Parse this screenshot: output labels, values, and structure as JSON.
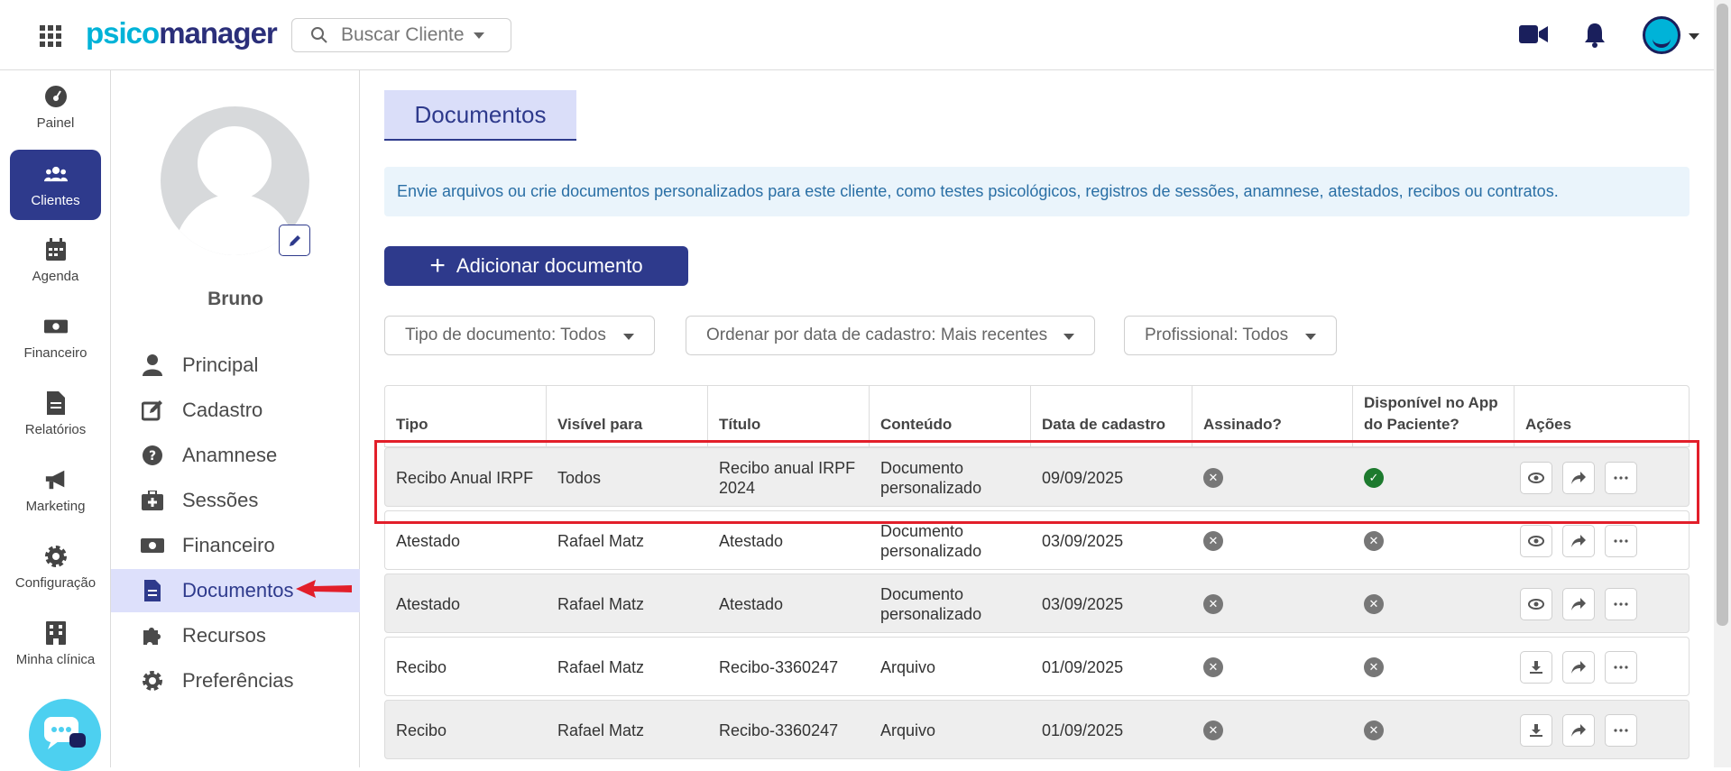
{
  "header": {
    "logo_part1": "psico",
    "logo_part2": "manager",
    "search_placeholder": "Buscar Cliente"
  },
  "leftnav": {
    "items": [
      {
        "label": "Painel",
        "icon": "dashboard-icon"
      },
      {
        "label": "Clientes",
        "icon": "users-icon",
        "active": true
      },
      {
        "label": "Agenda",
        "icon": "calendar-icon"
      },
      {
        "label": "Financeiro",
        "icon": "money-icon"
      },
      {
        "label": "Relatórios",
        "icon": "report-icon"
      },
      {
        "label": "Marketing",
        "icon": "megaphone-icon"
      },
      {
        "label": "Configuração",
        "icon": "gear-icon"
      },
      {
        "label": "Minha clínica",
        "icon": "building-icon"
      }
    ]
  },
  "client": {
    "name": "Bruno",
    "menu": [
      {
        "label": "Principal",
        "icon": "user-icon"
      },
      {
        "label": "Cadastro",
        "icon": "edit-icon"
      },
      {
        "label": "Anamnese",
        "icon": "question-icon"
      },
      {
        "label": "Sessões",
        "icon": "medkit-icon"
      },
      {
        "label": "Financeiro",
        "icon": "money-icon"
      },
      {
        "label": "Documentos",
        "icon": "file-icon",
        "active": true
      },
      {
        "label": "Recursos",
        "icon": "puzzle-icon"
      },
      {
        "label": "Preferências",
        "icon": "gear-icon"
      }
    ]
  },
  "main": {
    "title": "Documentos",
    "info": "Envie arquivos ou crie documentos personalizados para este cliente, como testes psicológicos, registros de sessões, anamnese, atestados, recibos ou contratos.",
    "add_button": "Adicionar documento",
    "filters": [
      "Tipo de documento: Todos",
      "Ordenar por data de cadastro: Mais recentes",
      "Profissional: Todos"
    ]
  },
  "table": {
    "columns": [
      "Tipo",
      "Visível para",
      "Título",
      "Conteúdo",
      "Data de cadastro",
      "Assinado?",
      "Disponível no App do Paciente?",
      "Ações"
    ],
    "rows": [
      {
        "tipo": "Recibo Anual IRPF",
        "visivel": "Todos",
        "titulo": "Recibo anual IRPF 2024",
        "conteudo": "Documento personalizado",
        "data": "09/09/2025",
        "assinado": false,
        "disponivel": true,
        "first_action": "eye-icon"
      },
      {
        "tipo": "Atestado",
        "visivel": "Rafael Matz",
        "titulo": "Atestado",
        "conteudo": "Documento personalizado",
        "data": "03/09/2025",
        "assinado": false,
        "disponivel": false,
        "first_action": "eye-icon"
      },
      {
        "tipo": "Atestado",
        "visivel": "Rafael Matz",
        "titulo": "Atestado",
        "conteudo": "Documento personalizado",
        "data": "03/09/2025",
        "assinado": false,
        "disponivel": false,
        "first_action": "eye-icon"
      },
      {
        "tipo": "Recibo",
        "visivel": "Rafael Matz",
        "titulo": "Recibo-3360247",
        "conteudo": "Arquivo",
        "data": "01/09/2025",
        "assinado": false,
        "disponivel": false,
        "first_action": "download-icon"
      },
      {
        "tipo": "Recibo",
        "visivel": "Rafael Matz",
        "titulo": "Recibo-3360247",
        "conteudo": "Arquivo",
        "data": "01/09/2025",
        "assinado": false,
        "disponivel": false,
        "first_action": "download-icon"
      }
    ]
  },
  "colors": {
    "primary": "#2e3a8c",
    "accent": "#00b3d8",
    "highlight": "#e21f2a",
    "success": "#1d7a2e"
  }
}
